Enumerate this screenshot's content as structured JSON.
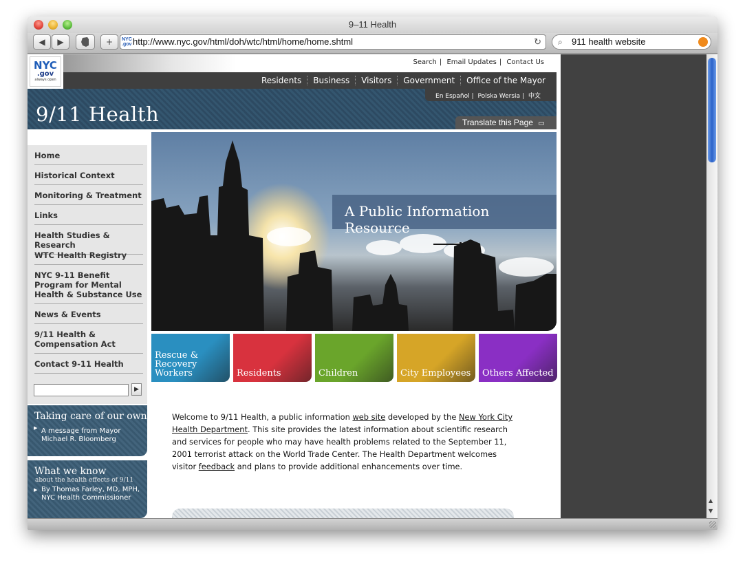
{
  "window": {
    "title": "9–11 Health"
  },
  "toolbar": {
    "back_icon": "◀",
    "forward_icon": "▶",
    "add_icon": "+",
    "url": "http://www.nyc.gov/html/doh/wtc/html/home/home.shtml",
    "search_value": "911 health website"
  },
  "logo": {
    "text": "NYC",
    "sub": ".gov",
    "tagline": "always open"
  },
  "utility_links": [
    "Search",
    "Email Updates",
    "Contact Us"
  ],
  "main_nav": [
    "Residents",
    "Business",
    "Visitors",
    "Government",
    "Office of the Mayor"
  ],
  "languages": [
    "En Español",
    "Polska Wersia",
    "中文"
  ],
  "site_title": "9/11 Health",
  "translate_label": "Translate this Page",
  "sidebar": {
    "items": [
      "Home",
      "Historical Context",
      "Monitoring & Treatment",
      "Links",
      "Health Studies & Research",
      "WTC Health Registry",
      "NYC 9-11 Benefit Program for Mental Health & Substance Use",
      "News & Events",
      "9/11 Health & Compensation Act",
      "Contact 9-11 Health"
    ],
    "search_value": "",
    "go_icon": "▶"
  },
  "promos": [
    {
      "title": "Taking care of our own",
      "subtitle": "",
      "text": "A message from Mayor Michael R. Bloomberg"
    },
    {
      "title": "What we know",
      "subtitle": "about the health effects of 9/11",
      "text": "By Thomas Farley, MD, MPH, NYC Health Commissioner"
    }
  ],
  "hero": {
    "tagline": "A Public Information Resource"
  },
  "audience_tiles": [
    {
      "label": "Rescue & Recovery Workers",
      "color": "#2a8fc0"
    },
    {
      "label": "Residents",
      "color": "#d8323e"
    },
    {
      "label": "Children",
      "color": "#6aa52b"
    },
    {
      "label": "City Employees",
      "color": "#d6a527"
    },
    {
      "label": "Others Affected",
      "color": "#8a2fc4"
    }
  ],
  "intro": {
    "p1": "Welcome to 9/11 Health, a public information ",
    "link1": "web site",
    "p2": " developed by the ",
    "link2": "New York City Health Department",
    "p3": ". This site provides the latest information about scientific research and services for people who may have health problems related to the September 11, 2001 terrorist attack on the World Trade Center. The Health Department welcomes visitor ",
    "link3": "feedback",
    "p4": " and plans to provide additional enhancements over time."
  }
}
